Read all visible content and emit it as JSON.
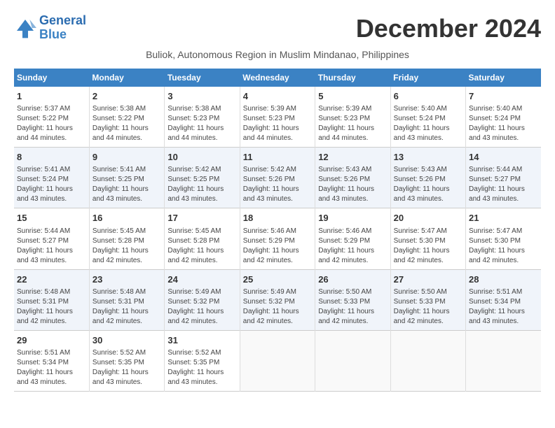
{
  "logo": {
    "line1": "General",
    "line2": "Blue"
  },
  "title": "December 2024",
  "subtitle": "Buliok, Autonomous Region in Muslim Mindanao, Philippines",
  "days_of_week": [
    "Sunday",
    "Monday",
    "Tuesday",
    "Wednesday",
    "Thursday",
    "Friday",
    "Saturday"
  ],
  "weeks": [
    [
      {
        "day": "1",
        "info": "Sunrise: 5:37 AM\nSunset: 5:22 PM\nDaylight: 11 hours\nand 44 minutes."
      },
      {
        "day": "2",
        "info": "Sunrise: 5:38 AM\nSunset: 5:22 PM\nDaylight: 11 hours\nand 44 minutes."
      },
      {
        "day": "3",
        "info": "Sunrise: 5:38 AM\nSunset: 5:23 PM\nDaylight: 11 hours\nand 44 minutes."
      },
      {
        "day": "4",
        "info": "Sunrise: 5:39 AM\nSunset: 5:23 PM\nDaylight: 11 hours\nand 44 minutes."
      },
      {
        "day": "5",
        "info": "Sunrise: 5:39 AM\nSunset: 5:23 PM\nDaylight: 11 hours\nand 44 minutes."
      },
      {
        "day": "6",
        "info": "Sunrise: 5:40 AM\nSunset: 5:24 PM\nDaylight: 11 hours\nand 43 minutes."
      },
      {
        "day": "7",
        "info": "Sunrise: 5:40 AM\nSunset: 5:24 PM\nDaylight: 11 hours\nand 43 minutes."
      }
    ],
    [
      {
        "day": "8",
        "info": "Sunrise: 5:41 AM\nSunset: 5:24 PM\nDaylight: 11 hours\nand 43 minutes."
      },
      {
        "day": "9",
        "info": "Sunrise: 5:41 AM\nSunset: 5:25 PM\nDaylight: 11 hours\nand 43 minutes."
      },
      {
        "day": "10",
        "info": "Sunrise: 5:42 AM\nSunset: 5:25 PM\nDaylight: 11 hours\nand 43 minutes."
      },
      {
        "day": "11",
        "info": "Sunrise: 5:42 AM\nSunset: 5:26 PM\nDaylight: 11 hours\nand 43 minutes."
      },
      {
        "day": "12",
        "info": "Sunrise: 5:43 AM\nSunset: 5:26 PM\nDaylight: 11 hours\nand 43 minutes."
      },
      {
        "day": "13",
        "info": "Sunrise: 5:43 AM\nSunset: 5:26 PM\nDaylight: 11 hours\nand 43 minutes."
      },
      {
        "day": "14",
        "info": "Sunrise: 5:44 AM\nSunset: 5:27 PM\nDaylight: 11 hours\nand 43 minutes."
      }
    ],
    [
      {
        "day": "15",
        "info": "Sunrise: 5:44 AM\nSunset: 5:27 PM\nDaylight: 11 hours\nand 43 minutes."
      },
      {
        "day": "16",
        "info": "Sunrise: 5:45 AM\nSunset: 5:28 PM\nDaylight: 11 hours\nand 42 minutes."
      },
      {
        "day": "17",
        "info": "Sunrise: 5:45 AM\nSunset: 5:28 PM\nDaylight: 11 hours\nand 42 minutes."
      },
      {
        "day": "18",
        "info": "Sunrise: 5:46 AM\nSunset: 5:29 PM\nDaylight: 11 hours\nand 42 minutes."
      },
      {
        "day": "19",
        "info": "Sunrise: 5:46 AM\nSunset: 5:29 PM\nDaylight: 11 hours\nand 42 minutes."
      },
      {
        "day": "20",
        "info": "Sunrise: 5:47 AM\nSunset: 5:30 PM\nDaylight: 11 hours\nand 42 minutes."
      },
      {
        "day": "21",
        "info": "Sunrise: 5:47 AM\nSunset: 5:30 PM\nDaylight: 11 hours\nand 42 minutes."
      }
    ],
    [
      {
        "day": "22",
        "info": "Sunrise: 5:48 AM\nSunset: 5:31 PM\nDaylight: 11 hours\nand 42 minutes."
      },
      {
        "day": "23",
        "info": "Sunrise: 5:48 AM\nSunset: 5:31 PM\nDaylight: 11 hours\nand 42 minutes."
      },
      {
        "day": "24",
        "info": "Sunrise: 5:49 AM\nSunset: 5:32 PM\nDaylight: 11 hours\nand 42 minutes."
      },
      {
        "day": "25",
        "info": "Sunrise: 5:49 AM\nSunset: 5:32 PM\nDaylight: 11 hours\nand 42 minutes."
      },
      {
        "day": "26",
        "info": "Sunrise: 5:50 AM\nSunset: 5:33 PM\nDaylight: 11 hours\nand 42 minutes."
      },
      {
        "day": "27",
        "info": "Sunrise: 5:50 AM\nSunset: 5:33 PM\nDaylight: 11 hours\nand 42 minutes."
      },
      {
        "day": "28",
        "info": "Sunrise: 5:51 AM\nSunset: 5:34 PM\nDaylight: 11 hours\nand 43 minutes."
      }
    ],
    [
      {
        "day": "29",
        "info": "Sunrise: 5:51 AM\nSunset: 5:34 PM\nDaylight: 11 hours\nand 43 minutes."
      },
      {
        "day": "30",
        "info": "Sunrise: 5:52 AM\nSunset: 5:35 PM\nDaylight: 11 hours\nand 43 minutes."
      },
      {
        "day": "31",
        "info": "Sunrise: 5:52 AM\nSunset: 5:35 PM\nDaylight: 11 hours\nand 43 minutes."
      },
      {
        "day": "",
        "info": ""
      },
      {
        "day": "",
        "info": ""
      },
      {
        "day": "",
        "info": ""
      },
      {
        "day": "",
        "info": ""
      }
    ]
  ]
}
